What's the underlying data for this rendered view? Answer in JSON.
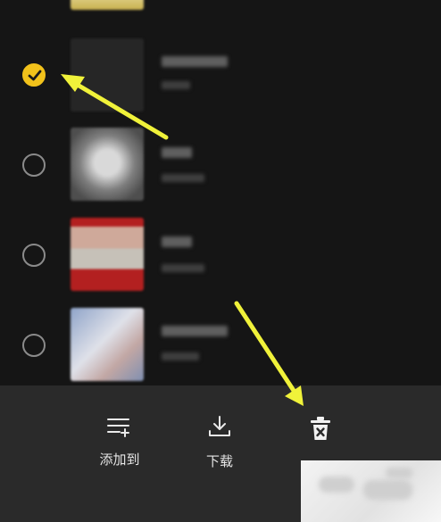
{
  "list": {
    "rows": [
      {
        "selected": false
      },
      {
        "selected": true
      },
      {
        "selected": false
      },
      {
        "selected": false
      },
      {
        "selected": false
      }
    ]
  },
  "toolbar": {
    "add_to_label": "添加到",
    "download_label": "下载"
  },
  "icons": {
    "add_to": "playlist-add-icon",
    "download": "download-icon",
    "delete": "trash-icon",
    "checked": "check-circle-icon",
    "unchecked": "circle-icon"
  },
  "colors": {
    "accent": "#f2c21b",
    "arrow": "#f0f23a",
    "background": "#151515",
    "toolbar_bg": "#2a2a2a"
  }
}
